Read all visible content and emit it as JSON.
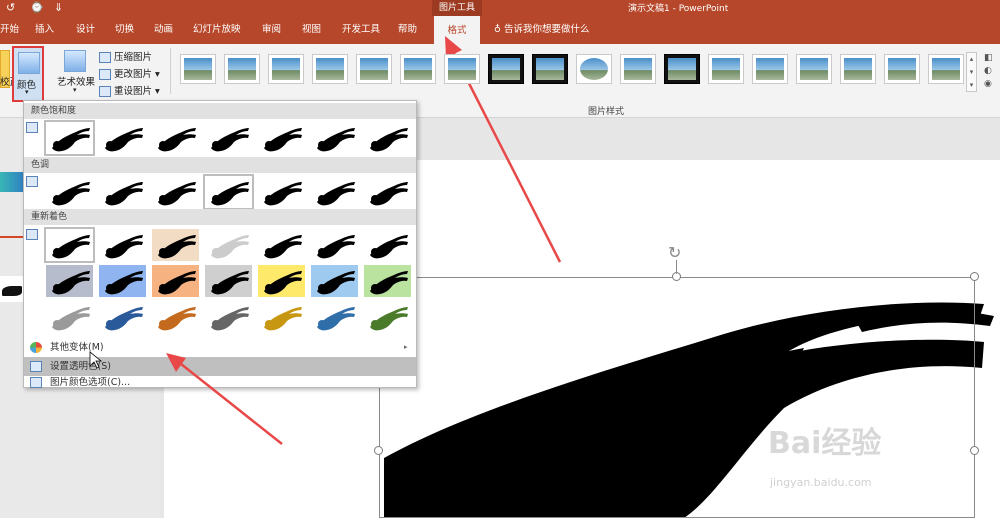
{
  "titlebar": {
    "quick_access": [
      "↺",
      "⌚",
      "⇓"
    ],
    "context_tab": "图片工具",
    "document_title": "演示文稿1 - PowerPoint"
  },
  "tabs": [
    {
      "label": "开始"
    },
    {
      "label": "插入"
    },
    {
      "label": "设计"
    },
    {
      "label": "切换"
    },
    {
      "label": "动画"
    },
    {
      "label": "幻灯片放映"
    },
    {
      "label": "审阅"
    },
    {
      "label": "视图"
    },
    {
      "label": "开发工具"
    },
    {
      "label": "帮助"
    },
    {
      "label": "格式",
      "active": true
    }
  ],
  "tell_me": "告诉我你想要做什么",
  "ribbon": {
    "correct_label": "校正",
    "color_label": "颜色",
    "artistic_label": "艺术效果",
    "compress_label": "压缩图片",
    "change_label": "更改图片",
    "reset_label": "重设图片",
    "group_label": "图片样式",
    "style_count": 18
  },
  "dropdown": {
    "saturation_header": "颜色饱和度",
    "tone_header": "色调",
    "recolor_header": "重新着色",
    "more_variants": "其他变体(M)",
    "set_transparent": "设置透明色(S)",
    "color_options": "图片颜色选项(C)...",
    "recolor_colors": [
      [
        "#ffffff",
        "#ffffff",
        "#f3dcc4",
        "#ffffff",
        "#ffffff",
        "#ffffff",
        "#ffffff"
      ],
      [
        "#b6bccb",
        "#8fb4ef",
        "#f7b282",
        "#cfcfcf",
        "#ffe96b",
        "#9fcaf0",
        "#b9e39f"
      ],
      [
        "#ffffff",
        "#ffffff",
        "#ffffff",
        "#ffffff",
        "#ffffff",
        "#ffffff",
        "#ffffff"
      ]
    ],
    "recolor_ink": [
      [
        "#000000",
        "#000000",
        "#000000",
        "#cccccc",
        "#000000",
        "#000000",
        "#000000"
      ],
      [
        "#000000",
        "#000000",
        "#000000",
        "#000000",
        "#000000",
        "#000000",
        "#000000"
      ],
      [
        "#9a9a9a",
        "#2b5a9a",
        "#c46a1f",
        "#666666",
        "#c79712",
        "#2f6ea8",
        "#4a7b2a"
      ]
    ]
  },
  "watermark": {
    "brand": "Bai经验",
    "url": "jingyan.baidu.com"
  }
}
